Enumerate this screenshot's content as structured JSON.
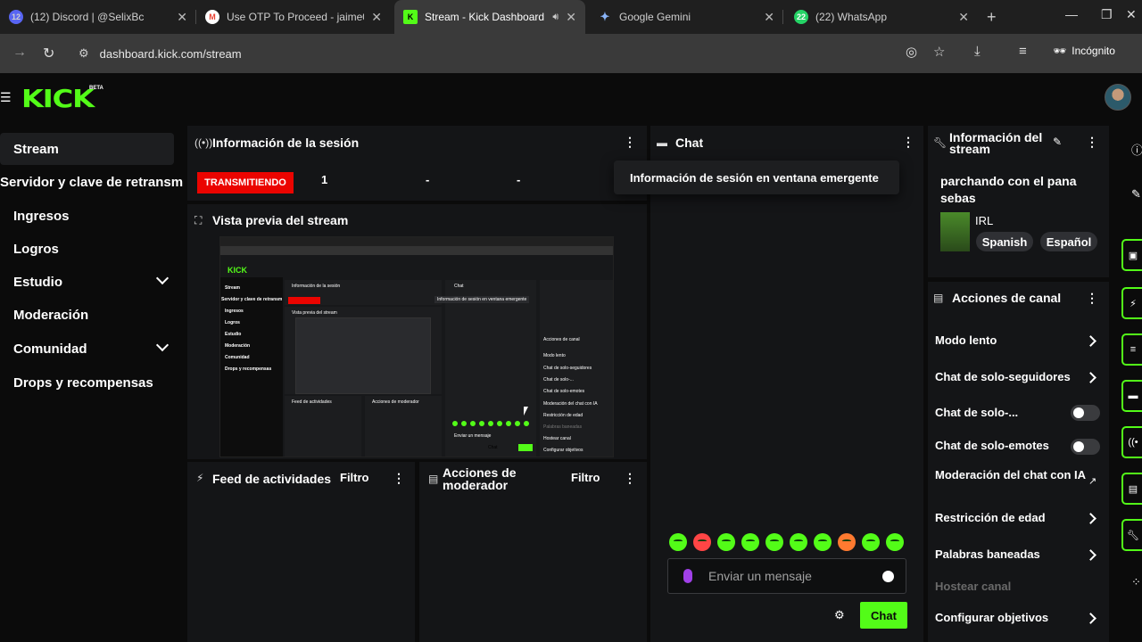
{
  "browser": {
    "tabs": [
      {
        "title": "(12) Discord | @SelixBc",
        "badge": "12"
      },
      {
        "title": "Use OTP To Proceed - jaime03"
      },
      {
        "title": "Stream - Kick Dashboard"
      },
      {
        "title": "Google Gemini"
      },
      {
        "title": "(22) WhatsApp",
        "badge": "22"
      }
    ],
    "url": "dashboard.kick.com/stream",
    "incognito_label": "Incógnito"
  },
  "header": {
    "logo": "KICK",
    "beta": "BETA"
  },
  "sidebar": {
    "items": [
      {
        "label": "Stream"
      },
      {
        "label": "Servidor y clave de retransm"
      },
      {
        "label": "Ingresos"
      },
      {
        "label": "Logros"
      },
      {
        "label": "Estudio"
      },
      {
        "label": "Moderación"
      },
      {
        "label": "Comunidad"
      },
      {
        "label": "Drops y recompensas"
      }
    ]
  },
  "session": {
    "title": "Información de la sesión",
    "status": "TRANSMITIENDO",
    "viewers": "1",
    "stat2": "-",
    "stat3": "-",
    "popup_tooltip": "Información de sesión en ventana emergente"
  },
  "preview": {
    "title": "Vista previa del stream",
    "mini_logo": "KICK",
    "mini_sidebar": [
      "Stream",
      "Servidor y clave de retransm",
      "Ingresos",
      "Logros",
      "Estudio",
      "Moderación",
      "Comunidad",
      "Drops y recompensas"
    ],
    "mini_session": "Información de la sesión",
    "mini_preview": "Vista previa del stream",
    "mini_chat": "Chat",
    "mini_tooltip": "Información de sesión en ventana emergente",
    "mini_actions": [
      "Acciones de canal",
      "Modo lento",
      "Chat de solo-seguidores",
      "Chat de solo-...",
      "Chat de solo-emotes",
      "Moderación del chat con IA",
      "Restricción de edad",
      "Palabras baneadas",
      "Hostear canal",
      "Configurar objetivos"
    ],
    "mini_feed": "Feed de actividades",
    "mini_mod": "Acciones de moderador",
    "mini_input": "Enviar un mensaje",
    "mini_chat_btn": "Chat"
  },
  "activity": {
    "title": "Feed de actividades",
    "filter": "Filtro"
  },
  "moderator": {
    "title_line1": "Acciones de",
    "title_line2": "moderador",
    "filter": "Filtro"
  },
  "chat": {
    "title": "Chat",
    "placeholder": "Enviar un mensaje",
    "send_label": "Chat"
  },
  "stream_info": {
    "title_line1": "Información del",
    "title_line2": "stream",
    "stream_title": "parchando con el pana sebas",
    "category": "IRL",
    "tags": [
      "Spanish",
      "Español"
    ]
  },
  "channel_actions": {
    "title": "Acciones de canal",
    "items": [
      {
        "label": "Modo lento"
      },
      {
        "label": "Chat de solo-seguidores"
      },
      {
        "label": "Chat de solo-..."
      },
      {
        "label": "Chat de solo-emotes"
      },
      {
        "label": "Moderación del chat con IA"
      },
      {
        "label": "Restricción de edad"
      },
      {
        "label": "Palabras baneadas"
      },
      {
        "label": "Hostear canal"
      },
      {
        "label": "Configurar objetivos"
      }
    ]
  },
  "colors": {
    "accent": "#53fc18",
    "live": "#eb0400",
    "panel": "#141517",
    "background": "#0b0b0b"
  }
}
